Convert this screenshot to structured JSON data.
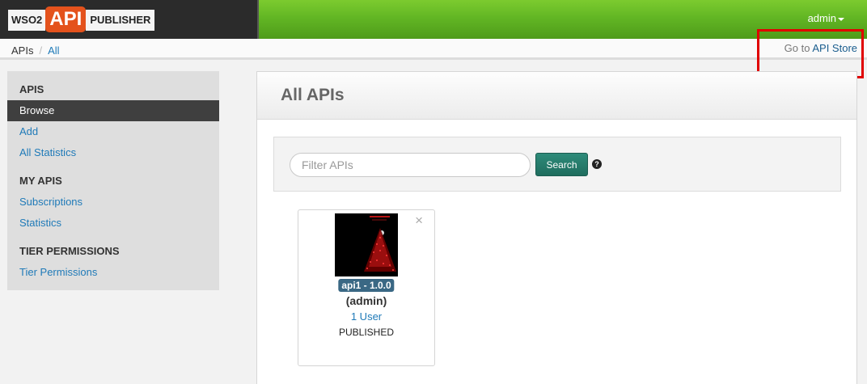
{
  "header": {
    "logo": {
      "wso2": "WSO2",
      "api": "API",
      "publisher": "PUBLISHER"
    },
    "user": "admin",
    "colors": {
      "brand_orange": "#e4521c",
      "header_green": "#62b624",
      "dark": "#2b2b2b"
    }
  },
  "breadcrumb": {
    "root": "APIs",
    "separator": "/",
    "current": "All"
  },
  "store_link": {
    "prefix": "Go to",
    "label": "API Store"
  },
  "sidebar": {
    "sections": [
      {
        "title": "APIS",
        "items": [
          {
            "label": "Browse",
            "active": true
          },
          {
            "label": "Add"
          },
          {
            "label": "All Statistics"
          }
        ]
      },
      {
        "title": "MY APIS",
        "items": [
          {
            "label": "Subscriptions"
          },
          {
            "label": "Statistics"
          }
        ]
      },
      {
        "title": "TIER PERMISSIONS",
        "items": [
          {
            "label": "Tier Permissions"
          }
        ]
      }
    ]
  },
  "main": {
    "title": "All APIs",
    "search": {
      "placeholder": "Filter APIs",
      "value": "",
      "button": "Search",
      "help_icon": "question-circle-icon",
      "help_glyph": "?"
    },
    "apis": [
      {
        "name": "api1 - 1.0.0",
        "owner": "(admin)",
        "users": "1 User",
        "status": "PUBLISHED",
        "thumbnail": "christmas-tree-image",
        "close_glyph": "×"
      }
    ]
  }
}
